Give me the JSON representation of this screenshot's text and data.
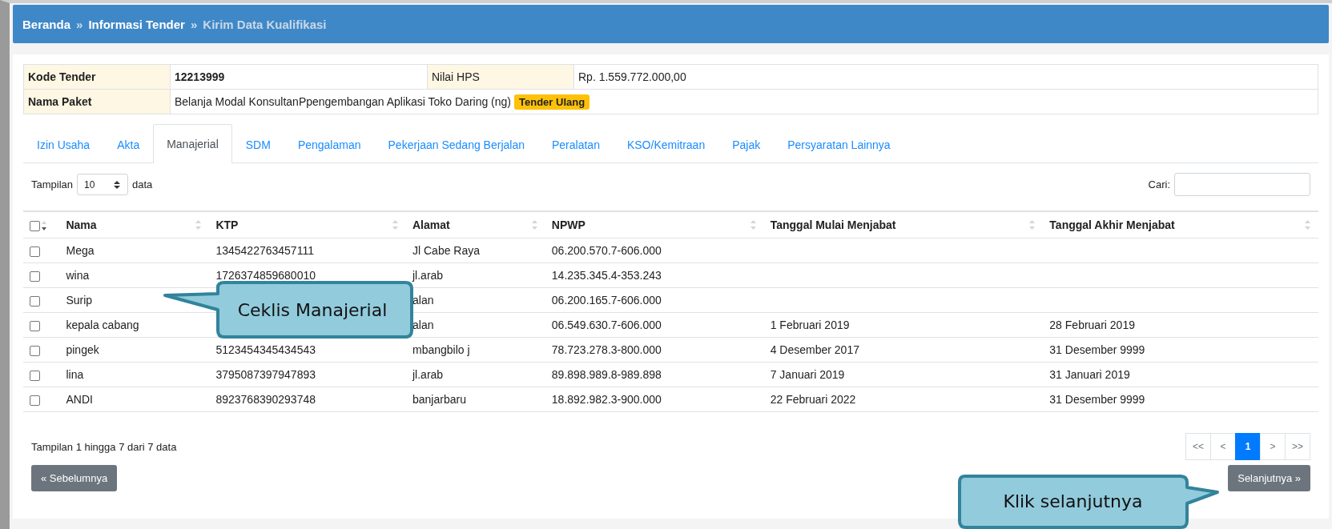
{
  "breadcrumb": [
    {
      "label": "Beranda",
      "active": false
    },
    {
      "label": "Informasi Tender",
      "active": false
    },
    {
      "label": "Kirim Data Kualifikasi",
      "active": true
    }
  ],
  "separator": "»",
  "info": {
    "rows": [
      {
        "label": "Kode Tender",
        "value": "12213999",
        "extra_label": "Nilai HPS",
        "extra_value": "Rp. 1.559.772.000,00"
      },
      {
        "label": "Nama Paket",
        "value": "Belanja Modal KonsultanPpengembangan Aplikasi Toko Daring (ng)",
        "badge": "Tender Ulang"
      }
    ]
  },
  "tabs": [
    {
      "label": "Izin Usaha",
      "selected": false
    },
    {
      "label": "Akta",
      "selected": false
    },
    {
      "label": "Manajerial",
      "selected": true
    },
    {
      "label": "SDM",
      "selected": false
    },
    {
      "label": "Pengalaman",
      "selected": false
    },
    {
      "label": "Pekerjaan Sedang Berjalan",
      "selected": false
    },
    {
      "label": "Peralatan",
      "selected": false
    },
    {
      "label": "KSO/Kemitraan",
      "selected": false
    },
    {
      "label": "Pajak",
      "selected": false
    },
    {
      "label": "Persyaratan Lainnya",
      "selected": false
    }
  ],
  "length": {
    "before": "Tampilan",
    "value": "10",
    "after": "data"
  },
  "search": {
    "label": "Cari:"
  },
  "table": {
    "select_all_checked": false,
    "columns": [
      "Nama",
      "KTP",
      "Alamat",
      "NPWP",
      "Tanggal Mulai Menjabat",
      "Tanggal Akhir Menjabat"
    ],
    "rows": [
      {
        "checked": false,
        "cells": [
          "Mega",
          "1345422763457111",
          "Jl Cabe Raya",
          "06.200.570.7-606.000",
          "",
          ""
        ]
      },
      {
        "checked": false,
        "cells": [
          "wina",
          "1726374859680010",
          "jl.arab",
          "14.235.345.4-353.243",
          "",
          ""
        ]
      },
      {
        "checked": false,
        "cells": [
          "Surip",
          "",
          "alan",
          "06.200.165.7-606.000",
          "",
          ""
        ]
      },
      {
        "checked": false,
        "cells": [
          "kepala cabang",
          "",
          "alan",
          "06.549.630.7-606.000",
          "1 Februari 2019",
          "28 Februari 2019"
        ]
      },
      {
        "checked": false,
        "cells": [
          "pingek",
          "5123454345434543",
          "mbangbilo j",
          "78.723.278.3-800.000",
          "4 Desember 2017",
          "31 Desember 9999"
        ]
      },
      {
        "checked": false,
        "cells": [
          "lina",
          "3795087397947893",
          "jl.arab",
          "89.898.989.8-989.898",
          "7 Januari 2019",
          "31 Januari 2019"
        ]
      },
      {
        "checked": false,
        "cells": [
          "ANDI",
          "8923768390293748",
          "banjarbaru",
          "18.892.982.3-900.000",
          "22 Februari 2022",
          "31 Desember 9999"
        ]
      }
    ]
  },
  "info_text": "Tampilan 1 hingga 7 dari 7 data",
  "pagination": [
    {
      "label": "<<",
      "selected": false
    },
    {
      "label": "<",
      "selected": false
    },
    {
      "label": "1",
      "selected": true
    },
    {
      "label": ">",
      "selected": false
    },
    {
      "label": ">>",
      "selected": false
    }
  ],
  "prev_button": "« Sebelumnya",
  "next_button": "Selanjutnya »",
  "callouts": [
    {
      "text": "Ceklis Manajerial",
      "kind": "left"
    },
    {
      "text": "Klik selanjutnya",
      "kind": "right"
    }
  ]
}
